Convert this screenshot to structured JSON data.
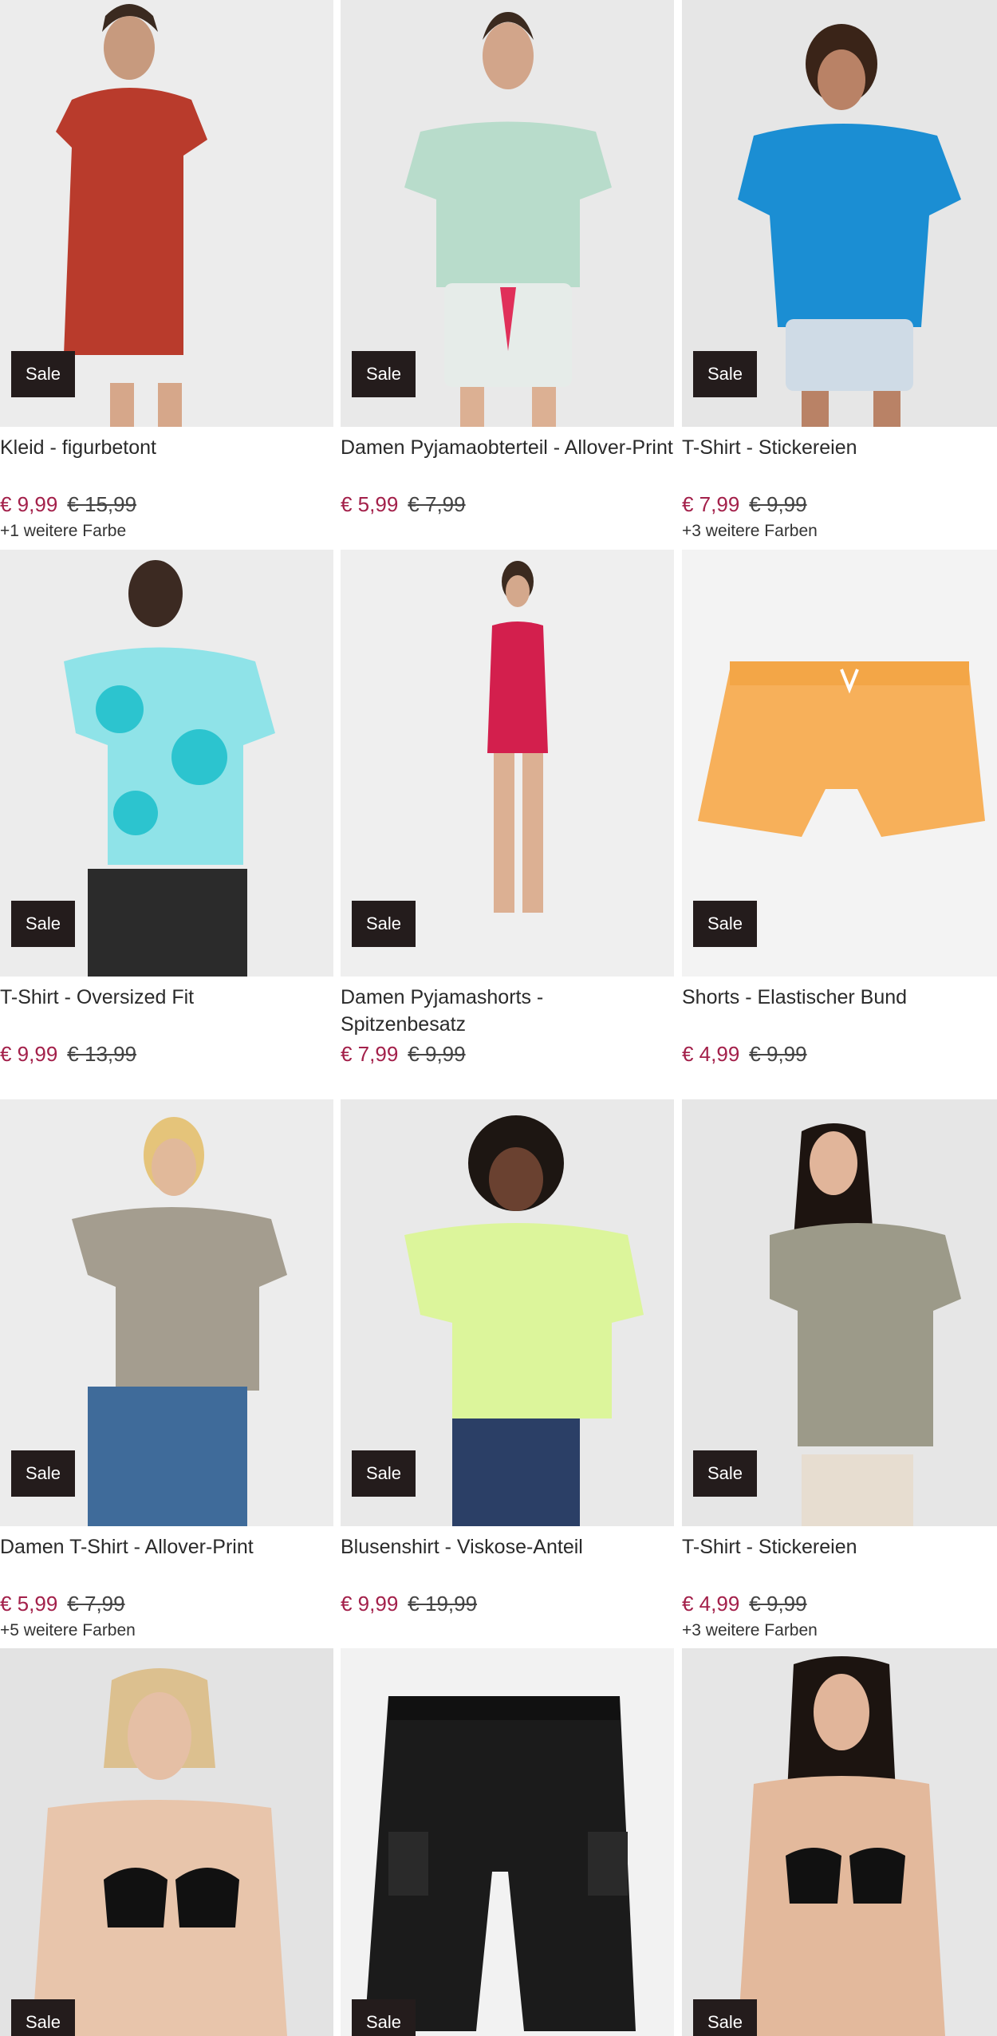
{
  "badge_label": "Sale",
  "colors": {
    "price_sale": "#a3204a",
    "badge_bg": "#241c1c"
  },
  "products": [
    {
      "title": "Kleid - figurbetont",
      "price": "€ 9,99",
      "old_price": "€ 15,99",
      "more_colors": "+1 weitere Farbe"
    },
    {
      "title": "Damen Pyjamaobterteil - Allover-Print",
      "price": "€ 5,99",
      "old_price": "€ 7,99",
      "more_colors": ""
    },
    {
      "title": "T-Shirt - Stickereien",
      "price": "€ 7,99",
      "old_price": "€ 9,99",
      "more_colors": "+3 weitere Farben"
    },
    {
      "title": "T-Shirt - Oversized Fit",
      "price": "€ 9,99",
      "old_price": "€ 13,99",
      "more_colors": ""
    },
    {
      "title": "Damen Pyjamashorts - Spitzenbesatz",
      "price": "€ 7,99",
      "old_price": "€ 9,99",
      "more_colors": ""
    },
    {
      "title": "Shorts - Elastischer Bund",
      "price": "€ 4,99",
      "old_price": "€ 9,99",
      "more_colors": ""
    },
    {
      "title": "Damen T-Shirt - Allover-Print",
      "price": "€ 5,99",
      "old_price": "€ 7,99",
      "more_colors": "+5 weitere Farben"
    },
    {
      "title": "Blusenshirt - Viskose-Anteil",
      "price": "€ 9,99",
      "old_price": "€ 19,99",
      "more_colors": ""
    },
    {
      "title": "T-Shirt - Stickereien",
      "price": "€ 4,99",
      "old_price": "€ 9,99",
      "more_colors": "+3 weitere Farben"
    },
    {
      "title": "",
      "price": "",
      "old_price": "",
      "more_colors": ""
    },
    {
      "title": "",
      "price": "",
      "old_price": "",
      "more_colors": ""
    },
    {
      "title": "",
      "price": "",
      "old_price": "",
      "more_colors": ""
    }
  ]
}
